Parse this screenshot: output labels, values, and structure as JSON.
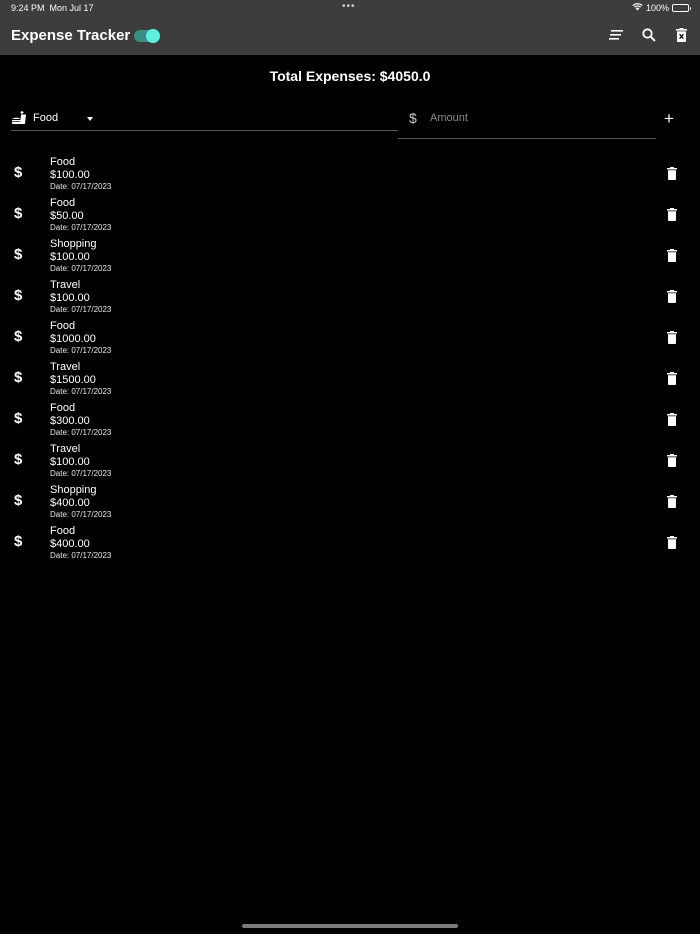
{
  "status_bar": {
    "time": "9:24 PM",
    "date": "Mon Jul 17",
    "battery": "100%"
  },
  "app_bar": {
    "title": "Expense Tracker",
    "toggle_on": true,
    "actions": [
      "sort-icon",
      "search-icon",
      "delete-all-icon"
    ]
  },
  "total_label": "Total Expenses: $4050.0",
  "form": {
    "category_value": "Food",
    "amount_placeholder": "Amount",
    "amount_value": ""
  },
  "colors": {
    "background": "#000000",
    "app_bar": "#3d3d3d",
    "toggle_accent": "#5ef0de"
  },
  "expenses": [
    {
      "category": "Food",
      "amount": "$100.00",
      "date": "Date: 07/17/2023"
    },
    {
      "category": "Food",
      "amount": "$50.00",
      "date": "Date: 07/17/2023"
    },
    {
      "category": "Shopping",
      "amount": "$100.00",
      "date": "Date: 07/17/2023"
    },
    {
      "category": "Travel",
      "amount": "$100.00",
      "date": "Date: 07/17/2023"
    },
    {
      "category": "Food",
      "amount": "$1000.00",
      "date": "Date: 07/17/2023"
    },
    {
      "category": "Travel",
      "amount": "$1500.00",
      "date": "Date: 07/17/2023"
    },
    {
      "category": "Food",
      "amount": "$300.00",
      "date": "Date: 07/17/2023"
    },
    {
      "category": "Travel",
      "amount": "$100.00",
      "date": "Date: 07/17/2023"
    },
    {
      "category": "Shopping",
      "amount": "$400.00",
      "date": "Date: 07/17/2023"
    },
    {
      "category": "Food",
      "amount": "$400.00",
      "date": "Date: 07/17/2023"
    }
  ]
}
